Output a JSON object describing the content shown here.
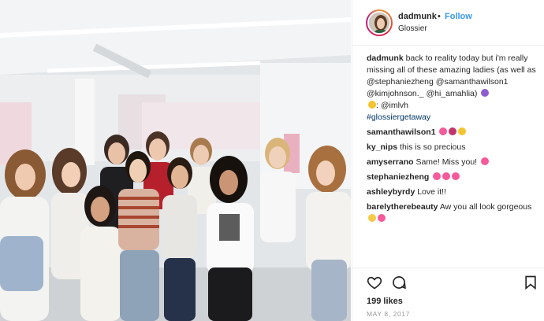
{
  "post": {
    "image_alt": "Group photo of women standing in a bright white gallery"
  },
  "header": {
    "username": "dadmunk",
    "separator": "•",
    "follow_label": "Follow",
    "location": "Glossier"
  },
  "caption": {
    "username": "dadmunk",
    "line1": "back to reality today but i'm really missing all of these amazing ladies (as well as @stephaniezheng @samanthawilson1 @kimjohnson._ @hi_amahlia)",
    "credit": ": @imlvh",
    "hashtag": "#glossiergetaway"
  },
  "comments": [
    {
      "username": "samanthawilson1",
      "text": ""
    },
    {
      "username": "ky_nips",
      "text": "this is so precious"
    },
    {
      "username": "amyserrano",
      "text": "Same! Miss you!"
    },
    {
      "username": "stephaniezheng",
      "text": ""
    },
    {
      "username": "ashleybyrdy",
      "text": "Love it!!"
    },
    {
      "username": "barelytherebeauty",
      "text": "Aw you all look gorgeous"
    }
  ],
  "footer": {
    "likes": "199 likes",
    "date": "MAY 8, 2017"
  },
  "icons": [
    "heart-icon",
    "comment-icon",
    "bookmark-icon"
  ],
  "colors": {
    "link": "#3897f0",
    "text": "#262626",
    "muted": "#999999",
    "border": "#efefef"
  }
}
